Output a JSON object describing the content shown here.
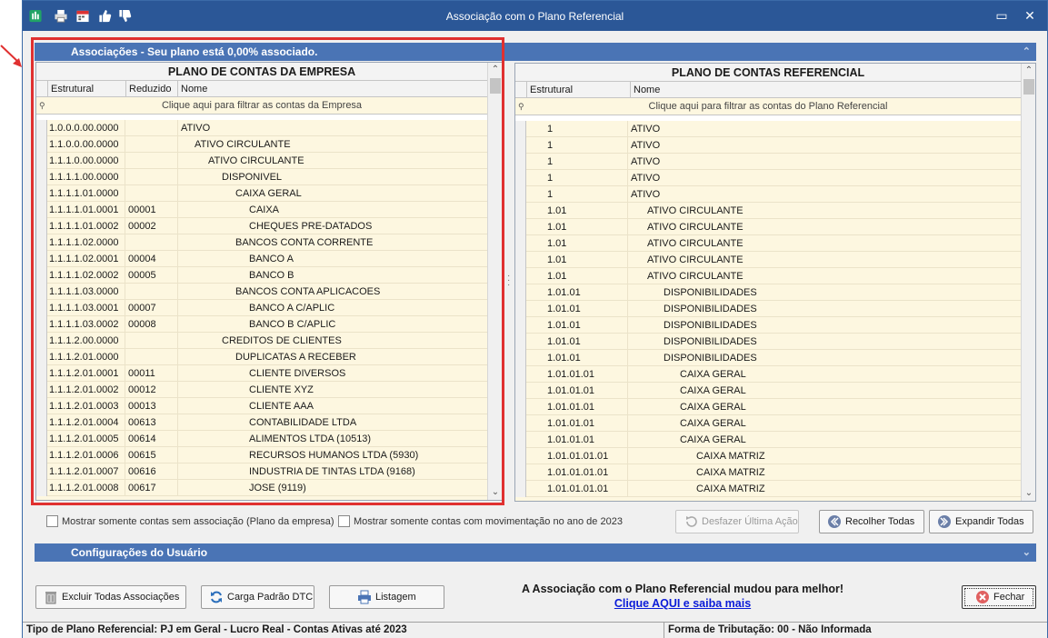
{
  "window": {
    "title": "Associação com o Plano Referencial",
    "minimize": "▭",
    "close": "✕",
    "toolbar_icons": [
      "spreadsheet-icon",
      "print-icon",
      "calendar-icon",
      "thumbs-up-icon",
      "thumbs-down-icon"
    ]
  },
  "associations": {
    "header": "Associações - Seu plano está 0,00% associado."
  },
  "empresa_grid": {
    "title": "PLANO DE CONTAS DA EMPRESA",
    "columns": [
      "Estrutural",
      "Reduzido",
      "Nome"
    ],
    "filter": "Clique aqui para filtrar as contas da Empresa",
    "rows": [
      {
        "estrutural": "1.0.0.0.00.0000",
        "reduzido": "",
        "nome": "ATIVO",
        "indent": 0
      },
      {
        "estrutural": "1.1.0.0.00.0000",
        "reduzido": "",
        "nome": "ATIVO CIRCULANTE",
        "indent": 1
      },
      {
        "estrutural": "1.1.1.0.00.0000",
        "reduzido": "",
        "nome": "ATIVO CIRCULANTE",
        "indent": 2
      },
      {
        "estrutural": "1.1.1.1.00.0000",
        "reduzido": "",
        "nome": "DISPONIVEL",
        "indent": 3
      },
      {
        "estrutural": "1.1.1.1.01.0000",
        "reduzido": "",
        "nome": "CAIXA GERAL",
        "indent": 4
      },
      {
        "estrutural": "1.1.1.1.01.0001",
        "reduzido": "00001",
        "nome": "CAIXA",
        "indent": 5
      },
      {
        "estrutural": "1.1.1.1.01.0002",
        "reduzido": "00002",
        "nome": "CHEQUES PRE-DATADOS",
        "indent": 5
      },
      {
        "estrutural": "1.1.1.1.02.0000",
        "reduzido": "",
        "nome": "BANCOS CONTA CORRENTE",
        "indent": 4
      },
      {
        "estrutural": "1.1.1.1.02.0001",
        "reduzido": "00004",
        "nome": "BANCO A",
        "indent": 5
      },
      {
        "estrutural": "1.1.1.1.02.0002",
        "reduzido": "00005",
        "nome": "BANCO B",
        "indent": 5
      },
      {
        "estrutural": "1.1.1.1.03.0000",
        "reduzido": "",
        "nome": "BANCOS CONTA APLICACOES",
        "indent": 4
      },
      {
        "estrutural": "1.1.1.1.03.0001",
        "reduzido": "00007",
        "nome": "BANCO A C/APLIC",
        "indent": 5
      },
      {
        "estrutural": "1.1.1.1.03.0002",
        "reduzido": "00008",
        "nome": "BANCO B C/APLIC",
        "indent": 5
      },
      {
        "estrutural": "1.1.1.2.00.0000",
        "reduzido": "",
        "nome": "CREDITOS DE CLIENTES",
        "indent": 3
      },
      {
        "estrutural": "1.1.1.2.01.0000",
        "reduzido": "",
        "nome": "DUPLICATAS A RECEBER",
        "indent": 4
      },
      {
        "estrutural": "1.1.1.2.01.0001",
        "reduzido": "00011",
        "nome": "CLIENTE DIVERSOS",
        "indent": 5
      },
      {
        "estrutural": "1.1.1.2.01.0002",
        "reduzido": "00012",
        "nome": "CLIENTE XYZ",
        "indent": 5
      },
      {
        "estrutural": "1.1.1.2.01.0003",
        "reduzido": "00013",
        "nome": "CLIENTE AAA",
        "indent": 5
      },
      {
        "estrutural": "1.1.1.2.01.0004",
        "reduzido": "00613",
        "nome": "CONTABILIDADE LTDA",
        "indent": 5
      },
      {
        "estrutural": "1.1.1.2.01.0005",
        "reduzido": "00614",
        "nome": "ALIMENTOS LTDA (10513)",
        "indent": 5
      },
      {
        "estrutural": "1.1.1.2.01.0006",
        "reduzido": "00615",
        "nome": "RECURSOS HUMANOS LTDA (5930)",
        "indent": 5
      },
      {
        "estrutural": "1.1.1.2.01.0007",
        "reduzido": "00616",
        "nome": "INDUSTRIA DE TINTAS  LTDA (9168)",
        "indent": 5
      },
      {
        "estrutural": "1.1.1.2.01.0008",
        "reduzido": "00617",
        "nome": "JOSE (9119)",
        "indent": 5
      }
    ]
  },
  "referencial_grid": {
    "title": "PLANO DE CONTAS REFERENCIAL",
    "columns": [
      "Estrutural",
      "Nome"
    ],
    "filter": "Clique aqui para filtrar as contas do Plano Referencial",
    "rows": [
      {
        "estrutural": "1",
        "nome": "ATIVO",
        "indent": 0
      },
      {
        "estrutural": "1",
        "nome": "ATIVO",
        "indent": 0
      },
      {
        "estrutural": "1",
        "nome": "ATIVO",
        "indent": 0
      },
      {
        "estrutural": "1",
        "nome": "ATIVO",
        "indent": 0
      },
      {
        "estrutural": "1",
        "nome": "ATIVO",
        "indent": 0
      },
      {
        "estrutural": "1.01",
        "nome": "ATIVO CIRCULANTE",
        "indent": 1
      },
      {
        "estrutural": "1.01",
        "nome": "ATIVO CIRCULANTE",
        "indent": 1
      },
      {
        "estrutural": "1.01",
        "nome": "ATIVO CIRCULANTE",
        "indent": 1
      },
      {
        "estrutural": "1.01",
        "nome": "ATIVO CIRCULANTE",
        "indent": 1
      },
      {
        "estrutural": "1.01",
        "nome": "ATIVO CIRCULANTE",
        "indent": 1
      },
      {
        "estrutural": "1.01.01",
        "nome": "DISPONIBILIDADES",
        "indent": 2
      },
      {
        "estrutural": "1.01.01",
        "nome": "DISPONIBILIDADES",
        "indent": 2
      },
      {
        "estrutural": "1.01.01",
        "nome": "DISPONIBILIDADES",
        "indent": 2
      },
      {
        "estrutural": "1.01.01",
        "nome": "DISPONIBILIDADES",
        "indent": 2
      },
      {
        "estrutural": "1.01.01",
        "nome": "DISPONIBILIDADES",
        "indent": 2
      },
      {
        "estrutural": "1.01.01.01",
        "nome": "CAIXA GERAL",
        "indent": 3
      },
      {
        "estrutural": "1.01.01.01",
        "nome": "CAIXA GERAL",
        "indent": 3
      },
      {
        "estrutural": "1.01.01.01",
        "nome": "CAIXA GERAL",
        "indent": 3
      },
      {
        "estrutural": "1.01.01.01",
        "nome": "CAIXA GERAL",
        "indent": 3
      },
      {
        "estrutural": "1.01.01.01",
        "nome": "CAIXA GERAL",
        "indent": 3
      },
      {
        "estrutural": "1.01.01.01.01",
        "nome": "CAIXA MATRIZ",
        "indent": 4
      },
      {
        "estrutural": "1.01.01.01.01",
        "nome": "CAIXA MATRIZ",
        "indent": 4
      },
      {
        "estrutural": "1.01.01.01.01",
        "nome": "CAIXA MATRIZ",
        "indent": 4
      }
    ]
  },
  "options": {
    "chk_sem_associacao": "Mostrar somente contas sem associação (Plano da empresa)",
    "chk_movimentacao": "Mostrar somente contas com movimentação no ano de 2023",
    "desfazer": "Desfazer Última Ação",
    "recolher": "Recolher Todas",
    "expandir": "Expandir Todas"
  },
  "user_config": {
    "header": "Configurações do Usuário"
  },
  "footer": {
    "excluir": "Excluir Todas Associações",
    "carga": "Carga Padrão DTC",
    "listagem": "Listagem",
    "message": "A Associação com o Plano Referencial mudou para melhor!",
    "link": "Clique AQUI e saiba mais",
    "fechar": "Fechar"
  },
  "status": {
    "tipo": "Tipo de Plano Referencial: PJ em Geral - Lucro Real - Contas Ativas até 2023",
    "forma": "Forma de Tributação: 00 - Não Informada"
  }
}
